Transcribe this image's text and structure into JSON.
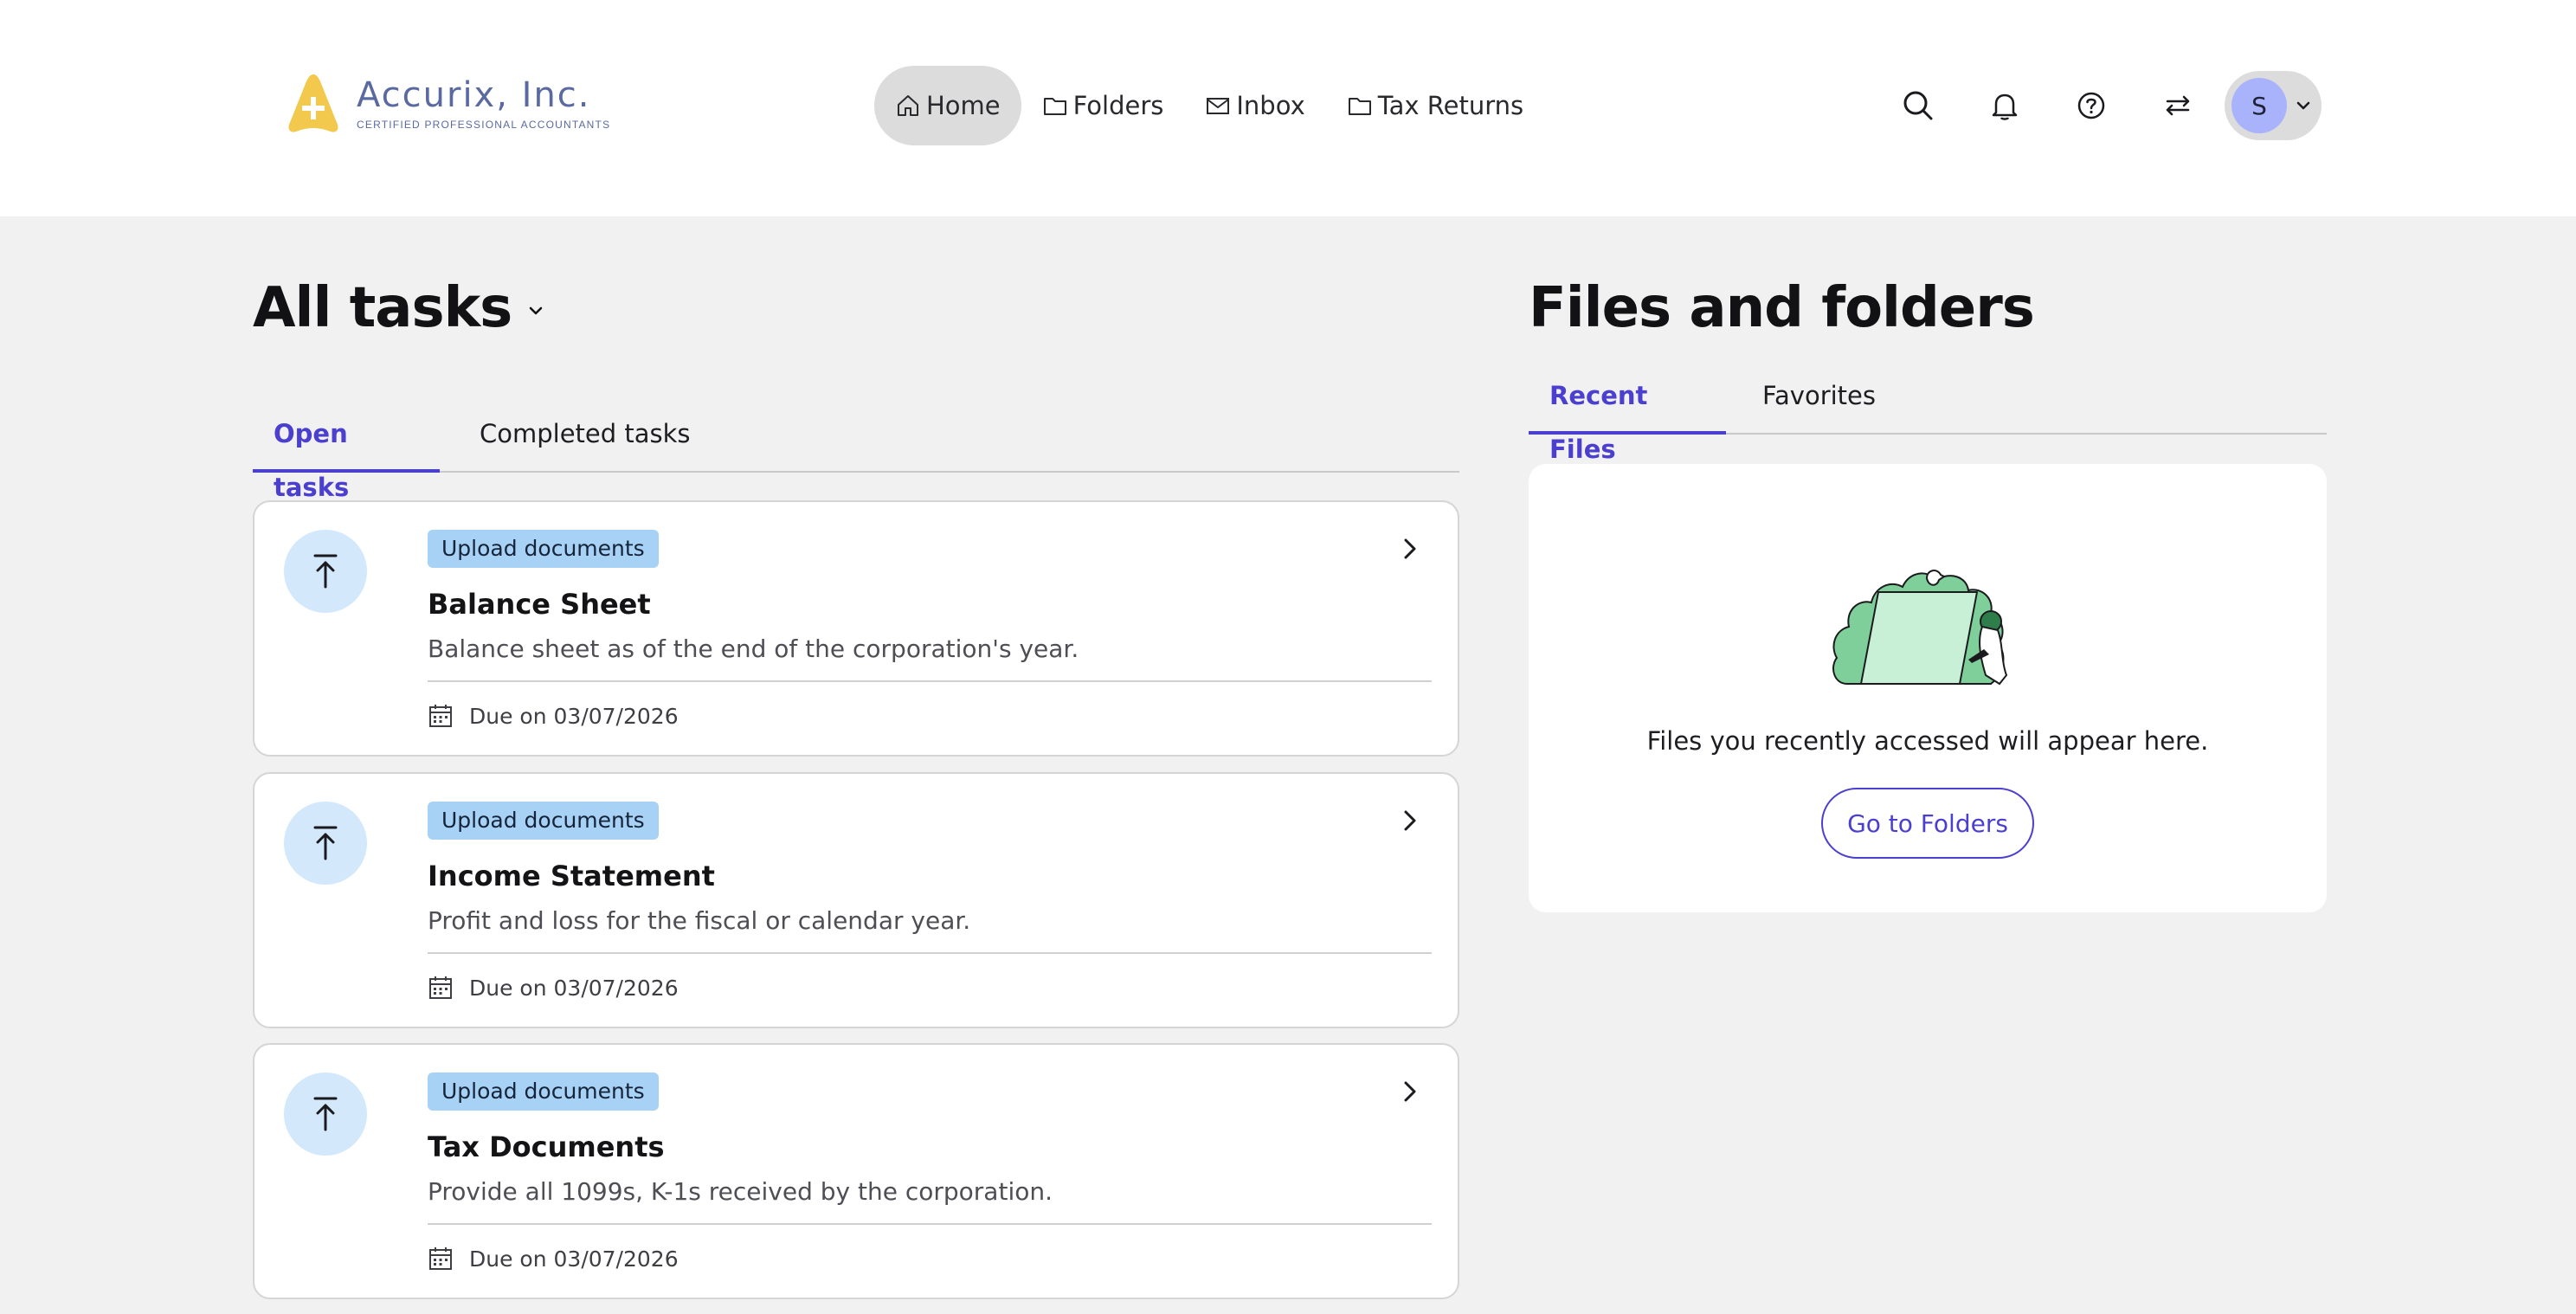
{
  "header": {
    "logo": {
      "name": "Accurix, Inc.",
      "subtitle": "CERTIFIED PROFESSIONAL ACCOUNTANTS",
      "color": "#f2c94c"
    },
    "nav": [
      {
        "label": "Home",
        "icon": "home-icon",
        "active": true
      },
      {
        "label": "Folders",
        "icon": "folder-icon",
        "active": false
      },
      {
        "label": "Inbox",
        "icon": "mail-icon",
        "active": false
      },
      {
        "label": "Tax Returns",
        "icon": "folder-icon",
        "active": false
      }
    ],
    "icons": [
      "search-icon",
      "bell-icon",
      "help-icon",
      "switch-icon"
    ],
    "user": {
      "initial": "S",
      "avatar_color": "#a9b3fb"
    }
  },
  "tasks": {
    "title": "All tasks",
    "tabs": [
      {
        "label": "Open tasks",
        "active": true
      },
      {
        "label": "Completed tasks",
        "active": false
      }
    ],
    "items": [
      {
        "badge": "Upload documents",
        "title": "Balance Sheet",
        "description": "Balance sheet as of the end of the corporation's year.",
        "due": "Due on 03/07/2026"
      },
      {
        "badge": "Upload documents",
        "title": "Income Statement",
        "description": "Profit and loss for the fiscal or calendar year.",
        "due": "Due on 03/07/2026"
      },
      {
        "badge": "Upload documents",
        "title": "Tax Documents",
        "description": "Provide all 1099s, K-1s received by the corporation.",
        "due": "Due on 03/07/2026"
      }
    ]
  },
  "files": {
    "title": "Files and folders",
    "tabs": [
      {
        "label": "Recent Files",
        "active": true
      },
      {
        "label": "Favorites",
        "active": false
      }
    ],
    "empty_message": "Files you recently accessed will appear here.",
    "button_label": "Go to Folders"
  },
  "colors": {
    "accent": "#4b3fd0",
    "badge": "#a7d2f5",
    "icon_bg": "#d3e8fb",
    "page_bg": "#f1f1f1"
  }
}
